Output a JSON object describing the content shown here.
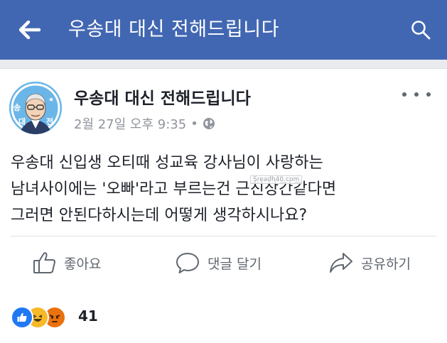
{
  "topbar": {
    "title": "우송대 대신 전해드립니다",
    "back_icon": "arrow-left-icon",
    "search_icon": "search-icon",
    "bg_color": "#4267b2"
  },
  "post": {
    "author": "우송대 대신 전해드립니다",
    "avatar_text_left": "송",
    "avatar_text_bottom_left": "대",
    "avatar_text_bottom_right": "전",
    "date": "2월 27일 오후 9:35",
    "separator": "•",
    "privacy_icon": "globe-icon",
    "more_icon": "more-horizontal-icon",
    "lines": [
      "우송대 신입생 오티때 성교육 강사님이 사랑하는",
      "남녀사이에는 '오빠'라고 부르는건 근친상간같다면",
      "그러면 안된다하시는데 어떻게 생각하시나요?"
    ],
    "watermark": "Sreadh40.com"
  },
  "actions": {
    "like": "좋아요",
    "comment": "댓글 달기",
    "share": "공유하기"
  },
  "reactions": {
    "icons": [
      "like-reaction-icon",
      "haha-reaction-icon",
      "angry-reaction-icon"
    ],
    "count": "41"
  }
}
